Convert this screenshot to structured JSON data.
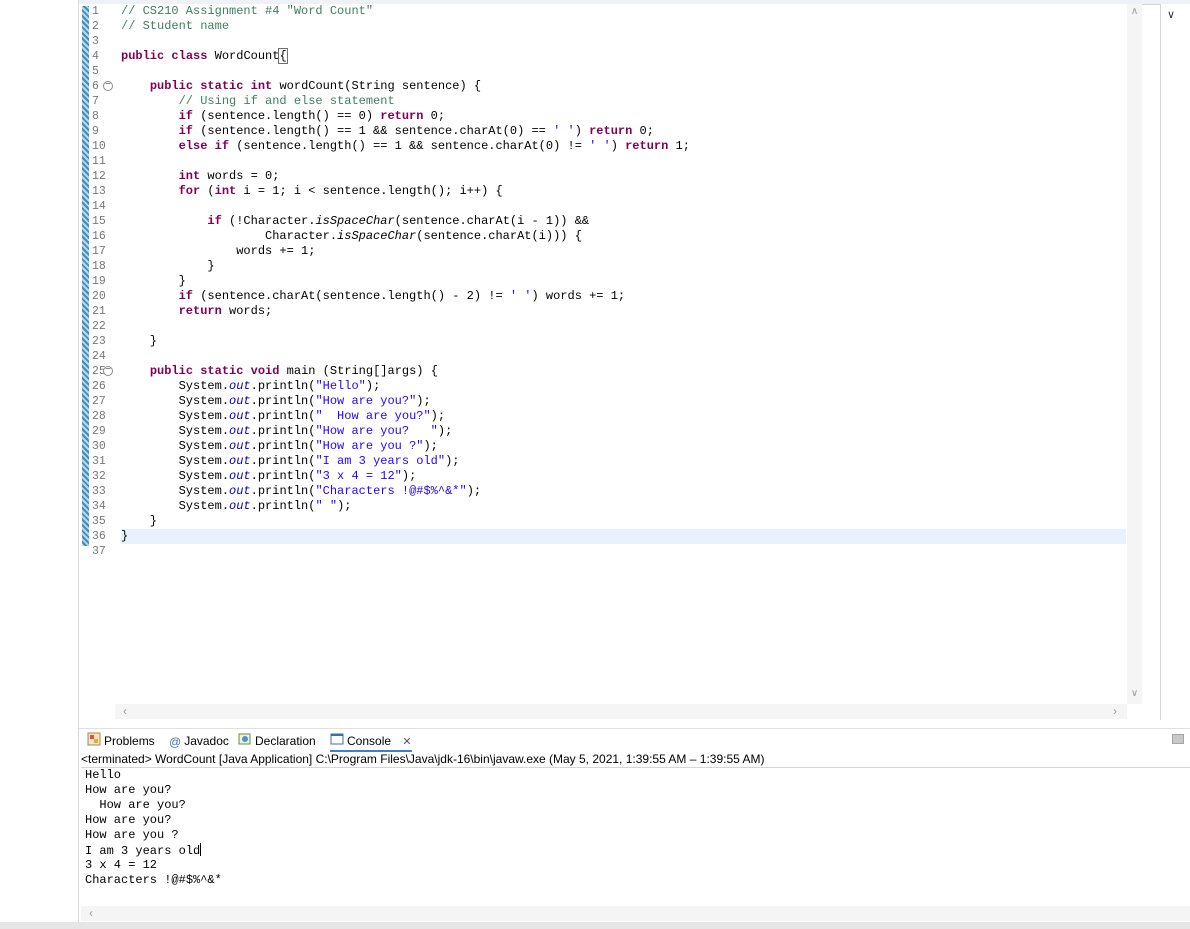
{
  "editor": {
    "lines": [
      {
        "no": "1",
        "fold": false,
        "current": false,
        "segs": [
          {
            "c": "cm",
            "t": "// CS210 Assignment #4 \"Word Count\""
          }
        ]
      },
      {
        "no": "2",
        "fold": false,
        "current": false,
        "segs": [
          {
            "c": "cm",
            "t": "// Student name"
          }
        ]
      },
      {
        "no": "3",
        "fold": false,
        "current": false,
        "segs": []
      },
      {
        "no": "4",
        "fold": false,
        "current": false,
        "segs": [
          {
            "c": "kw",
            "t": "public"
          },
          {
            "c": "",
            "t": " "
          },
          {
            "c": "kw",
            "t": "class"
          },
          {
            "c": "",
            "t": " WordCount"
          },
          {
            "c": "bracket",
            "t": "{"
          }
        ]
      },
      {
        "no": "5",
        "fold": false,
        "current": false,
        "segs": []
      },
      {
        "no": "6",
        "fold": true,
        "current": false,
        "segs": [
          {
            "c": "",
            "t": "    "
          },
          {
            "c": "kw",
            "t": "public"
          },
          {
            "c": "",
            "t": " "
          },
          {
            "c": "kw",
            "t": "static"
          },
          {
            "c": "",
            "t": " "
          },
          {
            "c": "kw",
            "t": "int"
          },
          {
            "c": "",
            "t": " wordCount(String sentence) {"
          }
        ]
      },
      {
        "no": "7",
        "fold": false,
        "current": false,
        "segs": [
          {
            "c": "",
            "t": "        "
          },
          {
            "c": "cm",
            "t": "// Using if and else statement"
          }
        ]
      },
      {
        "no": "8",
        "fold": false,
        "current": false,
        "segs": [
          {
            "c": "",
            "t": "        "
          },
          {
            "c": "kw",
            "t": "if"
          },
          {
            "c": "",
            "t": " (sentence.length() == 0) "
          },
          {
            "c": "kw",
            "t": "return"
          },
          {
            "c": "",
            "t": " 0;"
          }
        ]
      },
      {
        "no": "9",
        "fold": false,
        "current": false,
        "segs": [
          {
            "c": "",
            "t": "        "
          },
          {
            "c": "kw",
            "t": "if"
          },
          {
            "c": "",
            "t": " (sentence.length() == 1 && sentence.charAt(0) == "
          },
          {
            "c": "st",
            "t": "' '"
          },
          {
            "c": "",
            "t": ") "
          },
          {
            "c": "kw",
            "t": "return"
          },
          {
            "c": "",
            "t": " 0;"
          }
        ]
      },
      {
        "no": "10",
        "fold": false,
        "current": false,
        "segs": [
          {
            "c": "",
            "t": "        "
          },
          {
            "c": "kw",
            "t": "else"
          },
          {
            "c": "",
            "t": " "
          },
          {
            "c": "kw",
            "t": "if"
          },
          {
            "c": "",
            "t": " (sentence.length() == 1 && sentence.charAt(0) != "
          },
          {
            "c": "st",
            "t": "' '"
          },
          {
            "c": "",
            "t": ") "
          },
          {
            "c": "kw",
            "t": "return"
          },
          {
            "c": "",
            "t": " 1;"
          }
        ]
      },
      {
        "no": "11",
        "fold": false,
        "current": false,
        "segs": []
      },
      {
        "no": "12",
        "fold": false,
        "current": false,
        "segs": [
          {
            "c": "",
            "t": "        "
          },
          {
            "c": "kw",
            "t": "int"
          },
          {
            "c": "",
            "t": " words = 0;"
          }
        ]
      },
      {
        "no": "13",
        "fold": false,
        "current": false,
        "segs": [
          {
            "c": "",
            "t": "        "
          },
          {
            "c": "kw",
            "t": "for"
          },
          {
            "c": "",
            "t": " ("
          },
          {
            "c": "kw",
            "t": "int"
          },
          {
            "c": "",
            "t": " i = 1; i < sentence.length(); i++) {"
          }
        ]
      },
      {
        "no": "14",
        "fold": false,
        "current": false,
        "segs": []
      },
      {
        "no": "15",
        "fold": false,
        "current": false,
        "segs": [
          {
            "c": "",
            "t": "            "
          },
          {
            "c": "kw",
            "t": "if"
          },
          {
            "c": "",
            "t": " (!Character."
          },
          {
            "c": "it",
            "t": "isSpaceChar"
          },
          {
            "c": "",
            "t": "(sentence.charAt(i - 1)) &&"
          }
        ]
      },
      {
        "no": "16",
        "fold": false,
        "current": false,
        "segs": [
          {
            "c": "",
            "t": "                    Character."
          },
          {
            "c": "it",
            "t": "isSpaceChar"
          },
          {
            "c": "",
            "t": "(sentence.charAt(i))) {"
          }
        ]
      },
      {
        "no": "17",
        "fold": false,
        "current": false,
        "segs": [
          {
            "c": "",
            "t": "                words += 1;"
          }
        ]
      },
      {
        "no": "18",
        "fold": false,
        "current": false,
        "segs": [
          {
            "c": "",
            "t": "            }"
          }
        ]
      },
      {
        "no": "19",
        "fold": false,
        "current": false,
        "segs": [
          {
            "c": "",
            "t": "        }"
          }
        ]
      },
      {
        "no": "20",
        "fold": false,
        "current": false,
        "segs": [
          {
            "c": "",
            "t": "        "
          },
          {
            "c": "kw",
            "t": "if"
          },
          {
            "c": "",
            "t": " (sentence.charAt(sentence.length() - 2) != "
          },
          {
            "c": "st",
            "t": "' '"
          },
          {
            "c": "",
            "t": ") words += 1;"
          }
        ]
      },
      {
        "no": "21",
        "fold": false,
        "current": false,
        "segs": [
          {
            "c": "",
            "t": "        "
          },
          {
            "c": "kw",
            "t": "return"
          },
          {
            "c": "",
            "t": " words;"
          }
        ]
      },
      {
        "no": "22",
        "fold": false,
        "current": false,
        "segs": []
      },
      {
        "no": "23",
        "fold": false,
        "current": false,
        "segs": [
          {
            "c": "",
            "t": "    }"
          }
        ]
      },
      {
        "no": "24",
        "fold": false,
        "current": false,
        "segs": []
      },
      {
        "no": "25",
        "fold": true,
        "current": false,
        "segs": [
          {
            "c": "",
            "t": "    "
          },
          {
            "c": "kw",
            "t": "public"
          },
          {
            "c": "",
            "t": " "
          },
          {
            "c": "kw",
            "t": "static"
          },
          {
            "c": "",
            "t": " "
          },
          {
            "c": "kw",
            "t": "void"
          },
          {
            "c": "",
            "t": " main (String[]args) {"
          }
        ]
      },
      {
        "no": "26",
        "fold": false,
        "current": false,
        "segs": [
          {
            "c": "",
            "t": "        System."
          },
          {
            "c": "fld",
            "t": "out"
          },
          {
            "c": "",
            "t": ".println("
          },
          {
            "c": "st",
            "t": "\"Hello\""
          },
          {
            "c": "",
            "t": ");"
          }
        ]
      },
      {
        "no": "27",
        "fold": false,
        "current": false,
        "segs": [
          {
            "c": "",
            "t": "        System."
          },
          {
            "c": "fld",
            "t": "out"
          },
          {
            "c": "",
            "t": ".println("
          },
          {
            "c": "st",
            "t": "\"How are you?\""
          },
          {
            "c": "",
            "t": ");"
          }
        ]
      },
      {
        "no": "28",
        "fold": false,
        "current": false,
        "segs": [
          {
            "c": "",
            "t": "        System."
          },
          {
            "c": "fld",
            "t": "out"
          },
          {
            "c": "",
            "t": ".println("
          },
          {
            "c": "st",
            "t": "\"  How are you?\""
          },
          {
            "c": "",
            "t": ");"
          }
        ]
      },
      {
        "no": "29",
        "fold": false,
        "current": false,
        "segs": [
          {
            "c": "",
            "t": "        System."
          },
          {
            "c": "fld",
            "t": "out"
          },
          {
            "c": "",
            "t": ".println("
          },
          {
            "c": "st",
            "t": "\"How are you?   \""
          },
          {
            "c": "",
            "t": ");"
          }
        ]
      },
      {
        "no": "30",
        "fold": false,
        "current": false,
        "segs": [
          {
            "c": "",
            "t": "        System."
          },
          {
            "c": "fld",
            "t": "out"
          },
          {
            "c": "",
            "t": ".println("
          },
          {
            "c": "st",
            "t": "\"How are you ?\""
          },
          {
            "c": "",
            "t": ");"
          }
        ]
      },
      {
        "no": "31",
        "fold": false,
        "current": false,
        "segs": [
          {
            "c": "",
            "t": "        System."
          },
          {
            "c": "fld",
            "t": "out"
          },
          {
            "c": "",
            "t": ".println("
          },
          {
            "c": "st",
            "t": "\"I am 3 years old\""
          },
          {
            "c": "",
            "t": ");"
          }
        ]
      },
      {
        "no": "32",
        "fold": false,
        "current": false,
        "segs": [
          {
            "c": "",
            "t": "        System."
          },
          {
            "c": "fld",
            "t": "out"
          },
          {
            "c": "",
            "t": ".println("
          },
          {
            "c": "st",
            "t": "\"3 x 4 = 12\""
          },
          {
            "c": "",
            "t": ");"
          }
        ]
      },
      {
        "no": "33",
        "fold": false,
        "current": false,
        "segs": [
          {
            "c": "",
            "t": "        System."
          },
          {
            "c": "fld",
            "t": "out"
          },
          {
            "c": "",
            "t": ".println("
          },
          {
            "c": "st",
            "t": "\"Characters !@#$%^&*\""
          },
          {
            "c": "",
            "t": ");"
          }
        ]
      },
      {
        "no": "34",
        "fold": false,
        "current": false,
        "segs": [
          {
            "c": "",
            "t": "        System."
          },
          {
            "c": "fld",
            "t": "out"
          },
          {
            "c": "",
            "t": ".println("
          },
          {
            "c": "st",
            "t": "\" \""
          },
          {
            "c": "",
            "t": ");"
          }
        ]
      },
      {
        "no": "35",
        "fold": false,
        "current": false,
        "segs": [
          {
            "c": "",
            "t": "    }"
          }
        ]
      },
      {
        "no": "36",
        "fold": false,
        "current": true,
        "segs": [
          {
            "c": "",
            "t": "}"
          }
        ]
      },
      {
        "no": "37",
        "fold": false,
        "current": false,
        "segs": []
      }
    ]
  },
  "views": {
    "tabs": [
      {
        "label": "Problems",
        "icon": "problems-icon"
      },
      {
        "label": "Javadoc",
        "icon": "javadoc-icon"
      },
      {
        "label": "Declaration",
        "icon": "declaration-icon"
      },
      {
        "label": "Console",
        "icon": "console-icon"
      }
    ],
    "close_glyph": "✕",
    "at_glyph": "@"
  },
  "console": {
    "header": "<terminated> WordCount [Java Application] C:\\Program Files\\Java\\jdk-16\\bin\\javaw.exe  (May 5, 2021, 1:39:55 AM – 1:39:55 AM)",
    "output": [
      "Hello",
      "How are you?",
      "  How are you?",
      "How are you?",
      "How are you ?",
      "I am 3 years old",
      "3 x 4 = 12",
      "Characters !@#$%^&*"
    ]
  },
  "colors": {
    "keyword": "#7f0055",
    "comment": "#3f7f5f",
    "string": "#2a00ff",
    "field": "#0000c0",
    "current_line": "#e8f2fe"
  }
}
